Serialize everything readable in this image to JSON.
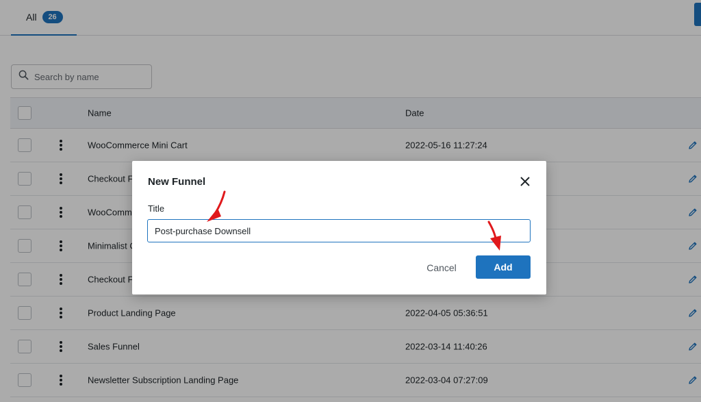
{
  "tabs": {
    "all_label": "All",
    "all_count": "26"
  },
  "search": {
    "placeholder": "Search by name"
  },
  "table": {
    "headers": {
      "name": "Name",
      "date": "Date"
    },
    "rows": [
      {
        "name": "WooCommerce Mini Cart",
        "date": "2022-05-16 11:27:24"
      },
      {
        "name": "Checkout F",
        "date": ""
      },
      {
        "name": "WooComme",
        "date": ""
      },
      {
        "name": "Minimalist C",
        "date": ""
      },
      {
        "name": "Checkout F",
        "date": ""
      },
      {
        "name": "Product Landing Page",
        "date": "2022-04-05 05:36:51"
      },
      {
        "name": "Sales Funnel",
        "date": "2022-03-14 11:40:26"
      },
      {
        "name": "Newsletter Subscription Landing Page",
        "date": "2022-03-04 07:27:09"
      }
    ]
  },
  "modal": {
    "title": "New Funnel",
    "field_label": "Title",
    "title_value": "Post-purchase Downsell",
    "cancel_label": "Cancel",
    "add_label": "Add"
  },
  "colors": {
    "accent": "#1e73be",
    "annotation_arrow": "#e0191c"
  },
  "icons": {
    "search": "search-icon",
    "close": "close-icon",
    "edit": "pencil-icon",
    "row_menu": "kebab-menu-icon"
  }
}
